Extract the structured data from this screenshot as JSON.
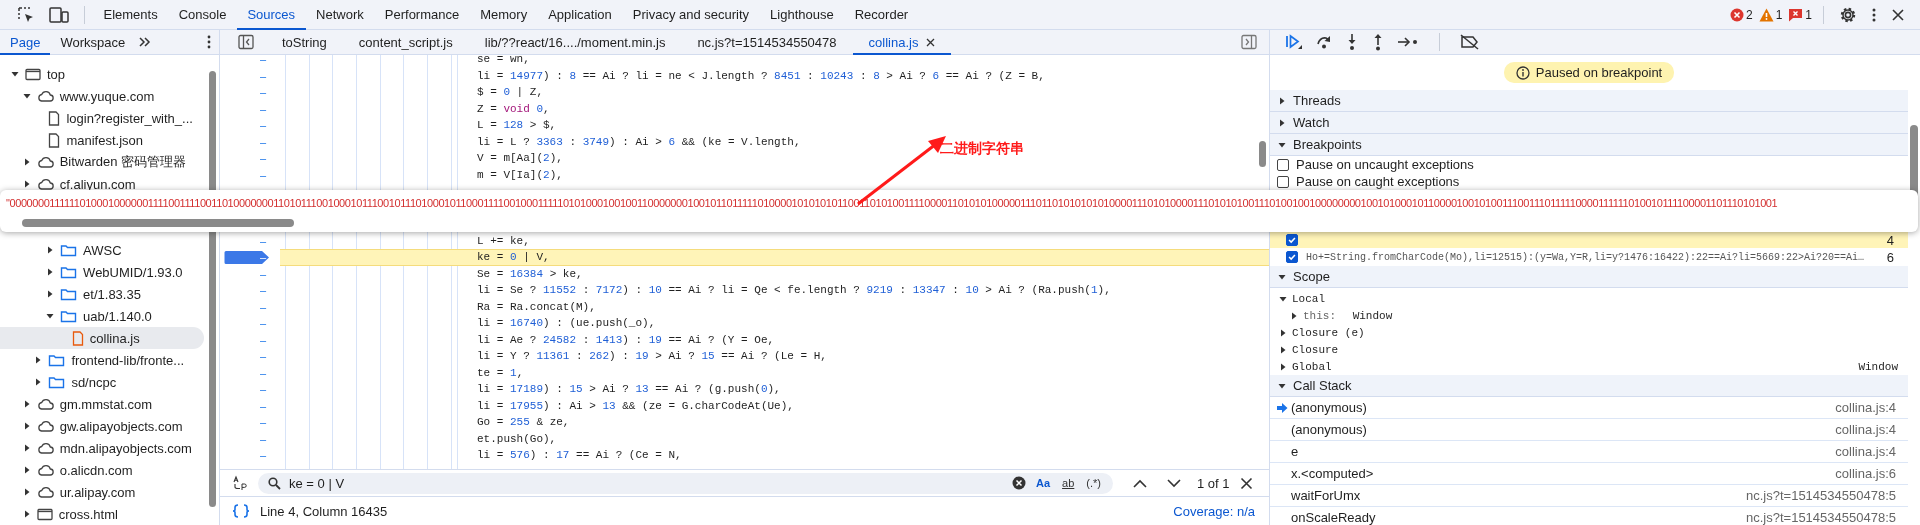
{
  "toolbar": {
    "tabs": [
      {
        "label": "Elements",
        "selected": false
      },
      {
        "label": "Console",
        "selected": false
      },
      {
        "label": "Sources",
        "selected": true
      },
      {
        "label": "Network",
        "selected": false
      },
      {
        "label": "Performance",
        "selected": false
      },
      {
        "label": "Memory",
        "selected": false
      },
      {
        "label": "Application",
        "selected": false
      },
      {
        "label": "Privacy and security",
        "selected": false
      },
      {
        "label": "Lighthouse",
        "selected": false
      },
      {
        "label": "Recorder",
        "selected": false
      }
    ],
    "counts": [
      {
        "kind": "error",
        "count": "2"
      },
      {
        "kind": "warning",
        "count": "1"
      },
      {
        "kind": "message",
        "count": "1"
      }
    ]
  },
  "navigator": {
    "tabs": [
      {
        "label": "Page",
        "selected": true
      },
      {
        "label": "Workspace",
        "selected": false
      }
    ],
    "tree": [
      {
        "label": "top",
        "kind": "frame",
        "expanded": true,
        "selected": false,
        "children": [
          {
            "label": "www.yuque.com",
            "kind": "domain",
            "expanded": true,
            "selected": false,
            "children": [
              {
                "label": "login?register_with_...",
                "kind": "document",
                "selected": false
              },
              {
                "label": "manifest.json",
                "kind": "document",
                "selected": false
              }
            ]
          },
          {
            "label": "Bitwarden 密码管理器",
            "kind": "domain",
            "expanded": false,
            "selected": false
          },
          {
            "label": "cf.aliyun.com",
            "kind": "domain",
            "expanded": false,
            "selected": false
          },
          {
            "children": [
              {
                "children": [
                  {
                    "label": "AWSC",
                    "kind": "folder",
                    "expanded": false,
                    "selected": false
                  },
                  {
                    "label": "WebUMID/1.93.0",
                    "kind": "folder",
                    "expanded": false,
                    "selected": false
                  },
                  {
                    "label": "et/1.83.35",
                    "kind": "folder",
                    "expanded": false,
                    "selected": false
                  },
                  {
                    "label": "uab/1.140.0",
                    "kind": "folder",
                    "expanded": true,
                    "selected": false,
                    "children": [
                      {
                        "label": "collina.js",
                        "kind": "script",
                        "selected": true
                      }
                    ]
                  }
                ]
              },
              {
                "label": "frontend-lib/fronte...",
                "kind": "folder",
                "expanded": false,
                "selected": false
              },
              {
                "label": "sd/ncpc",
                "kind": "folder",
                "expanded": false,
                "selected": false
              }
            ]
          },
          {
            "label": "gm.mmstat.com",
            "kind": "domain",
            "expanded": false,
            "selected": false
          },
          {
            "label": "gw.alipayobjects.com",
            "kind": "domain",
            "expanded": false,
            "selected": false
          },
          {
            "label": "mdn.alipayobjects.com",
            "kind": "domain",
            "expanded": false,
            "selected": false
          },
          {
            "label": "o.alicdn.com",
            "kind": "domain",
            "expanded": false,
            "selected": false
          },
          {
            "label": "ur.alipay.com",
            "kind": "domain",
            "expanded": false,
            "selected": false
          },
          {
            "label": "cross.html",
            "kind": "frame",
            "expanded": false,
            "selected": false
          }
        ]
      }
    ]
  },
  "editor": {
    "tabs": [
      {
        "label": "toString",
        "selected": false
      },
      {
        "label": "content_script.js",
        "selected": false
      },
      {
        "label": "lib/??react/16..../moment.min.js",
        "selected": false
      },
      {
        "label": "nc.js?t=1514534550478",
        "selected": false
      },
      {
        "label": "collina.js",
        "selected": true
      }
    ],
    "lines_above": [
      {
        "number": "–",
        "code": "se = wn,",
        "current": false,
        "breakpoint": false
      },
      {
        "number": "–",
        "code": "li = 14977) : 8 == Ai ? li = ne < J.length ? 8451 : 10243 : 8 > Ai ? 6 == Ai ? (Z = B,",
        "current": false,
        "breakpoint": false
      },
      {
        "number": "–",
        "code": "$ = 0 | Z,",
        "current": false,
        "breakpoint": false
      },
      {
        "number": "–",
        "parts": [
          {
            "text": "Z = ",
            "kind": "plain"
          },
          {
            "text": "void",
            "kind": "keyword"
          },
          {
            "text": " 0,",
            "kind": "plain"
          }
        ],
        "current": false,
        "breakpoint": false
      },
      {
        "number": "–",
        "code": "L = 128 > $,",
        "current": false,
        "breakpoint": false
      },
      {
        "number": "–",
        "code": "li = L ? 3363 : 3749) : Ai > 6 && (ke = V.length,",
        "current": false,
        "breakpoint": false
      },
      {
        "number": "–",
        "code": "V = m[Aa](2),",
        "current": false,
        "breakpoint": false
      },
      {
        "number": "–",
        "code": "m = V[Ia](2),",
        "current": false,
        "breakpoint": false
      }
    ],
    "lines_below": [
      {
        "number": "–",
        "code": "L += ke,",
        "current": false,
        "breakpoint": false
      },
      {
        "number": "–",
        "code": "ke = 0 | V,",
        "current": true,
        "breakpoint": true
      },
      {
        "number": "–",
        "code": "Se = 16384 > ke,",
        "current": false,
        "breakpoint": false
      },
      {
        "number": "–",
        "code": "li = Se ? 11552 : 7172) : 10 == Ai ? li = Qe < fe.length ? 9219 : 13347 : 10 > Ai ? (Ra.push(1),",
        "current": false,
        "breakpoint": false
      },
      {
        "number": "–",
        "code": "Ra = Ra.concat(M),",
        "current": false,
        "breakpoint": false
      },
      {
        "number": "–",
        "code": "li = 16740) : (ue.push(_o),",
        "current": false,
        "breakpoint": false
      },
      {
        "number": "–",
        "code": "li = Ae ? 24582 : 1413) : 19 == Ai ? (Y = Oe,",
        "current": false,
        "breakpoint": false
      },
      {
        "number": "–",
        "code": "li = Y ? 11361 : 262) : 19 > Ai ? 15 == Ai ? (Le = H,",
        "current": false,
        "breakpoint": false
      },
      {
        "number": "–",
        "code": "te = 1,",
        "current": false,
        "breakpoint": false
      },
      {
        "number": "–",
        "code": "li = 17189) : 15 > Ai ? 13 == Ai ? (g.push(0),",
        "current": false,
        "breakpoint": false
      },
      {
        "number": "–",
        "code": "li = 17955) : Ai > 13 && (ze = G.charCodeAt(Ue),",
        "current": false,
        "breakpoint": false
      },
      {
        "number": "–",
        "code": "Go = 255 & ze,",
        "current": false,
        "breakpoint": false
      },
      {
        "number": "–",
        "code": "et.push(Go),",
        "current": false,
        "breakpoint": false
      },
      {
        "number": "–",
        "code": "li = 576) : 17 == Ai ? (Ce = N,",
        "current": false,
        "breakpoint": false
      }
    ],
    "search": {
      "value": "ke = 0 | V",
      "options": [
        {
          "label": "Aa",
          "on": true
        },
        {
          "label": "ab",
          "on": false
        },
        {
          "label": "(.*)",
          "on": false
        }
      ],
      "count": "1 of 1"
    },
    "status": {
      "position": "Line 4, Column 16435",
      "coverage": "Coverage: n/a"
    }
  },
  "debugger": {
    "banner": "Paused on breakpoint",
    "sections": [
      {
        "title": "Threads",
        "expanded": false
      },
      {
        "title": "Watch",
        "expanded": false
      },
      {
        "title": "Breakpoints",
        "expanded": true
      }
    ],
    "pause_options": [
      {
        "label": "Pause on uncaught exceptions",
        "checked": false
      },
      {
        "label": "Pause on caught exceptions",
        "checked": false
      }
    ],
    "breakpoints": [
      {
        "line": "4",
        "checked": true,
        "current": true
      },
      {
        "code": "Ho+=String.fromCharCode(Mo),li=12515):(y=Wa,Y=R,li=y?1476:16422):22==Ai?li=5669:22>Ai?20==Ai…",
        "line": "6",
        "checked": true,
        "current": false
      }
    ],
    "scope": {
      "title": "Scope",
      "expanded": true,
      "items": [
        {
          "label": "Local",
          "expanded": true,
          "children": [
            {
              "name": "this:",
              "value": "Window",
              "expanded": false
            }
          ]
        },
        {
          "label": "Closure (e)",
          "expanded": false
        },
        {
          "label": "Closure",
          "expanded": false
        },
        {
          "label": "Global",
          "value": "Window",
          "expanded": false
        }
      ]
    },
    "call_stack": {
      "title": "Call Stack",
      "expanded": true,
      "frames": [
        {
          "name": "(anonymous)",
          "location": "collina.js:4",
          "selected": true
        },
        {
          "name": "(anonymous)",
          "location": "collina.js:4",
          "selected": false
        },
        {
          "name": "e",
          "location": "collina.js:4",
          "selected": false
        },
        {
          "name": "x.<computed>",
          "location": "collina.js:6",
          "selected": false
        },
        {
          "name": "waitForUmx",
          "location": "nc.js?t=1514534550478:5",
          "selected": false
        },
        {
          "name": "onScaleReady",
          "location": "nc.js?t=1514534550478:5",
          "selected": false
        }
      ]
    }
  },
  "tooltip": {
    "value": "\"00000001111110100010000001111001111001101000000011010111001000101110010111010001011000111100100011111010100010010011000000010010110111110100001010101011001101010011110000110101010000011101101010101010000111010100001110101010011101001001000000001001010001011000010010100111001110111110000111111010010111100001101110101001"
  },
  "annotation": {
    "label": "二进制字符串"
  }
}
